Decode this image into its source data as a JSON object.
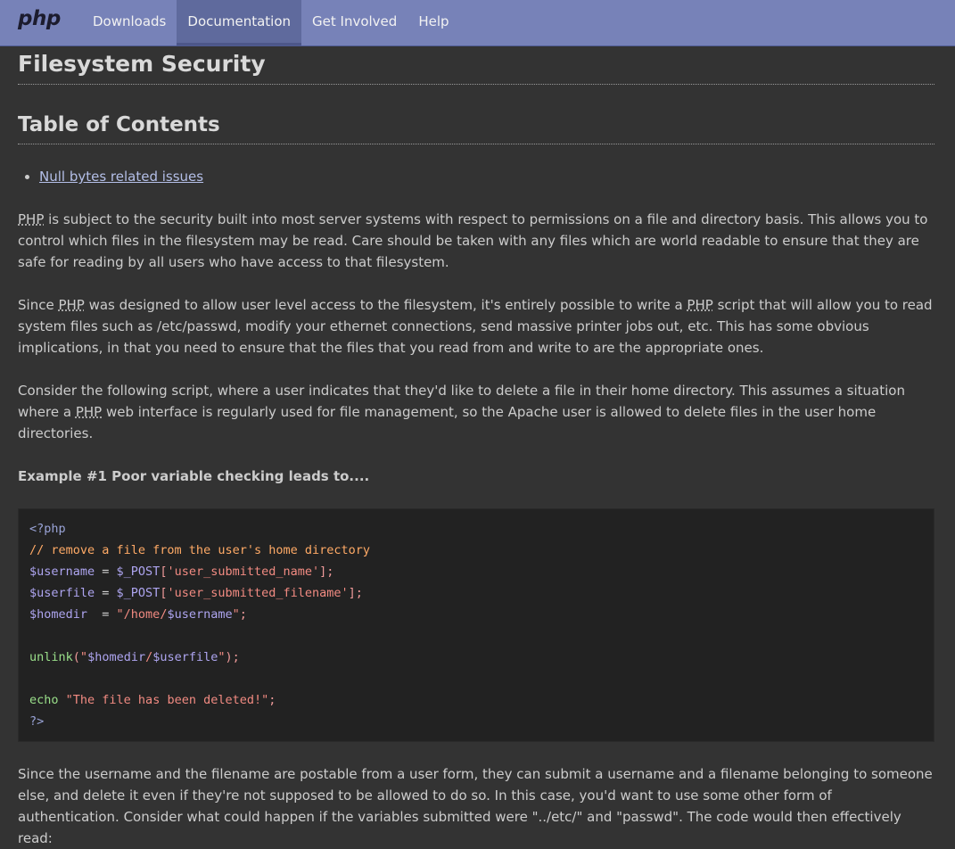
{
  "nav": {
    "logo": "php",
    "items": [
      "Downloads",
      "Documentation",
      "Get Involved",
      "Help"
    ],
    "active_index": 1
  },
  "page": {
    "title": "Filesystem Security",
    "toc_title": "Table of Contents",
    "toc_items": [
      "Null bytes related issues"
    ]
  },
  "paragraphs": {
    "p1": {
      "abbr": "PHP",
      "text": " is subject to the security built into most server systems with respect to permissions on a file and directory basis. This allows you to control which files in the filesystem may be read. Care should be taken with any files which are world readable to ensure that they are safe for reading by all users who have access to that filesystem."
    },
    "p2": {
      "t1": "Since ",
      "abbr1": "PHP",
      "t2": " was designed to allow user level access to the filesystem, it's entirely possible to write a ",
      "abbr2": "PHP",
      "t3": " script that will allow you to read system files such as /etc/passwd, modify your ethernet connections, send massive printer jobs out, etc. This has some obvious implications, in that you need to ensure that the files that you read from and write to are the appropriate ones."
    },
    "p3": {
      "t1": "Consider the following script, where a user indicates that they'd like to delete a file in their home directory. This assumes a situation where a ",
      "abbr": "PHP",
      "t2": " web interface is regularly used for file management, so the Apache user is allowed to delete files in the user home directories."
    },
    "example_title": "Example #1 Poor variable checking leads to....",
    "p4": "Since the username and the filename are postable from a user form, they can submit a username and a filename belonging to someone else, and delete it even if they're not supposed to be allowed to do so. In this case, you'd want to use some other form of authentication. Consider what could happen if the variables submitted were \"../etc/\" and \"passwd\". The code would then effectively read:"
  },
  "code": {
    "open_tag": "<?php",
    "comment": "// remove a file from the user's home directory",
    "l1_var": "$username",
    "l1_eq": " = ",
    "l1_post": "$_POST",
    "l1_open": "[",
    "l1_key": "'user_submitted_name'",
    "l1_close": "];",
    "l2_var": "$userfile",
    "l2_eq": " = ",
    "l2_post": "$_POST",
    "l2_open": "[",
    "l2_key": "'user_submitted_filename'",
    "l2_close": "];",
    "l3_var": "$homedir",
    "l3_eq": "  = ",
    "l3_str1": "\"/home/",
    "l3_var2": "$username",
    "l3_str2": "\"",
    "l3_end": ";",
    "l4_func": "unlink",
    "l4_open": "(",
    "l4_q1": "\"",
    "l4_v1": "$homedir",
    "l4_slash": "/",
    "l4_v2": "$userfile",
    "l4_q2": "\"",
    "l4_close": ");",
    "l5_key": "echo",
    "l5_str": "\"The file has been deleted!\"",
    "l5_end": ";",
    "close_tag": "?>"
  },
  "colors": {
    "navbar": "#7782b8",
    "background": "#333333",
    "code_background": "#222222",
    "link": "#b4bfe8"
  }
}
